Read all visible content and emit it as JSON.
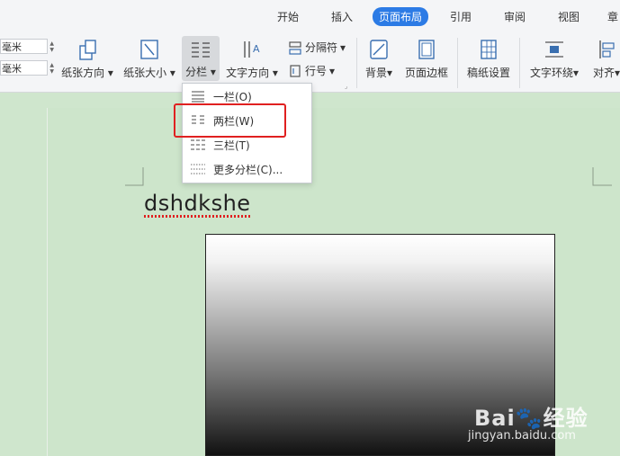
{
  "tabs": [
    "开始",
    "插入",
    "页面布局",
    "引用",
    "审阅",
    "视图",
    "章"
  ],
  "active_tab": "页面布局",
  "margins": {
    "top_value": "毫米",
    "bottom_value": "毫米"
  },
  "ribbon": {
    "orientation": "纸张方向",
    "size": "纸张大小",
    "columns": "分栏",
    "text_direction": "文字方向",
    "separator": "分隔符",
    "line_number": "行号",
    "background": "背景",
    "page_border": "页面边框",
    "manuscript": "稿纸设置",
    "text_wrap": "文字环绕",
    "align": "对齐"
  },
  "dropdown": {
    "items": [
      "一栏(O)",
      "两栏(W)",
      "三栏(T)",
      "更多分栏(C)..."
    ]
  },
  "document": {
    "text": "dshdkshe"
  },
  "watermark": {
    "brand": "Bai",
    "sub": "经验",
    "url": "jingyan.baidu.com"
  },
  "colors": {
    "accent": "#2c7be5",
    "page_bg": "#cfe6cd",
    "highlight": "#e02020"
  }
}
